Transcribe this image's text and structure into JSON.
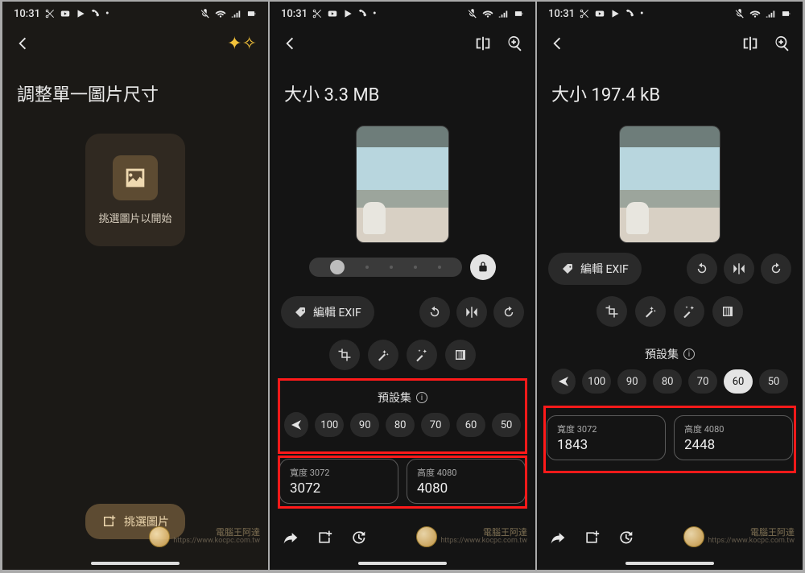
{
  "status": {
    "time": "10:31"
  },
  "panel1": {
    "title": "調整單一圖片尺寸",
    "pick_label": "挑選圖片以開始",
    "fab_label": "挑選圖片"
  },
  "panel2": {
    "title": "大小 3.3 MB",
    "exif_label": "編輯 EXIF",
    "preset_label": "預設集",
    "presets": [
      "100",
      "90",
      "80",
      "70",
      "60",
      "50"
    ],
    "selected_preset": null,
    "width_label": "寬度 3072",
    "width_value": "3072",
    "height_label": "高度 4080",
    "height_value": "4080"
  },
  "panel3": {
    "title": "大小 197.4 kB",
    "exif_label": "編輯 EXIF",
    "preset_label": "預設集",
    "presets": [
      "100",
      "90",
      "80",
      "70",
      "60",
      "50"
    ],
    "selected_preset": "60",
    "width_label": "寬度 3072",
    "width_value": "1843",
    "height_label": "高度 4080",
    "height_value": "2448"
  },
  "watermark": {
    "text": "電腦王阿達",
    "url": "https://www.kocpc.com.tw"
  }
}
